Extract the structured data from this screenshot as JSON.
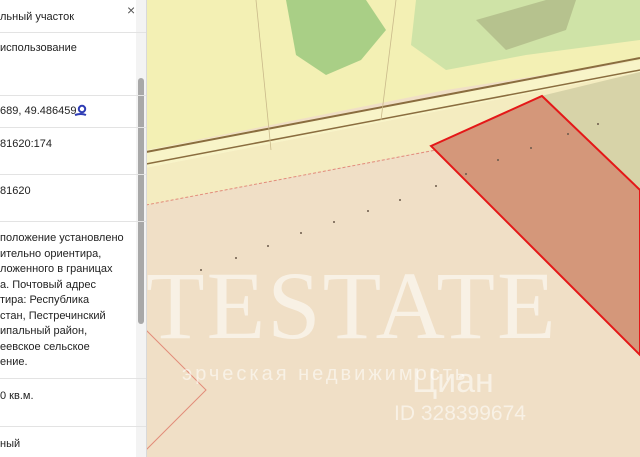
{
  "panel": {
    "close_icon": "×",
    "rows": [
      {
        "lines": [
          "льный участок"
        ]
      },
      {
        "lines": [
          "использование"
        ]
      },
      {
        "lines": [
          "689, 49.486459"
        ],
        "icon": "location-pin-icon"
      },
      {
        "lines": [
          "81620:174"
        ]
      },
      {
        "lines": [
          "81620"
        ]
      },
      {
        "lines": [
          "положение установлено",
          "ительно ориентира,",
          "ложенного в границах",
          "а. Почтовый адрес",
          "тира: Республика",
          "стан, Пестречинский",
          "ипальный район,",
          "еевское сельское",
          "ение."
        ]
      },
      {
        "lines": [
          "0 кв.м."
        ]
      },
      {
        "lines": [
          "ный"
        ]
      }
    ]
  },
  "watermark": {
    "big": "TESTATE",
    "sub": "эрческая недвижимость",
    "brand": "Циан",
    "id": "ID 328399674"
  },
  "colors": {
    "land": "#f0dfc6",
    "green": "#f3f0b4",
    "road": "#8a6d3f",
    "parcel_fill": "#d4977a",
    "parcel_border": "#e41818"
  }
}
